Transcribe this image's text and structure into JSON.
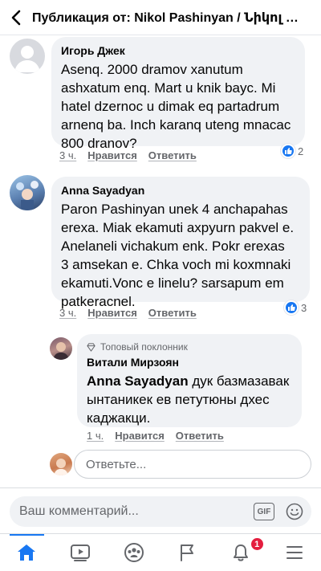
{
  "header": {
    "title": "Публикация от: Nikol Pashinyan / Նիկոլ Փաշինյան"
  },
  "comments": [
    {
      "author": "Игорь Джек",
      "text": "Asenq. 2000 dramov xanutum\nashxatum enq. Mart u knik bayc. Mi\nhatel dzernoc u dimak eq partadrum\narnenq ba. Inch karanq uteng mnacac\n800 dranov?",
      "time": "3 ч.",
      "like_label": "Нравится",
      "reply_label": "Ответить",
      "reaction_count": "2"
    },
    {
      "author": "Anna Sayadyan",
      "text": "Paron Pashinyan unek 4 anchapahas\nerexa. Miak ekamuti axpyurn  pakvel e.\nAnelaneli vichakum enk. Pokr  erexas\n3 amsekan e. Chka voch mi koxmnaki\nekamuti.Vonc e linelu? sarsapum em\npatkeracnel.",
      "time": "3 ч.",
      "like_label": "Нравится",
      "reply_label": "Ответить",
      "reaction_count": "3"
    }
  ],
  "reply": {
    "badge": "Топовый поклонник",
    "author": "Витали Мирзоян",
    "mention": "Anna Sayadyan",
    "text": " дук базмазавак\nынтаникек ев петутюны дхес\nкаджакци.",
    "time": "1 ч.",
    "like_label": "Нравится",
    "reply_label": "Ответить"
  },
  "reply_input": {
    "placeholder": "Ответьте..."
  },
  "composer": {
    "placeholder": "Ваш комментарий...",
    "gif_label": "GIF"
  },
  "tabbar": {
    "notification_count": "1"
  },
  "colors": {
    "accent": "#1877f2",
    "badge": "#e41e3f",
    "bubble": "#f0f2f5"
  }
}
